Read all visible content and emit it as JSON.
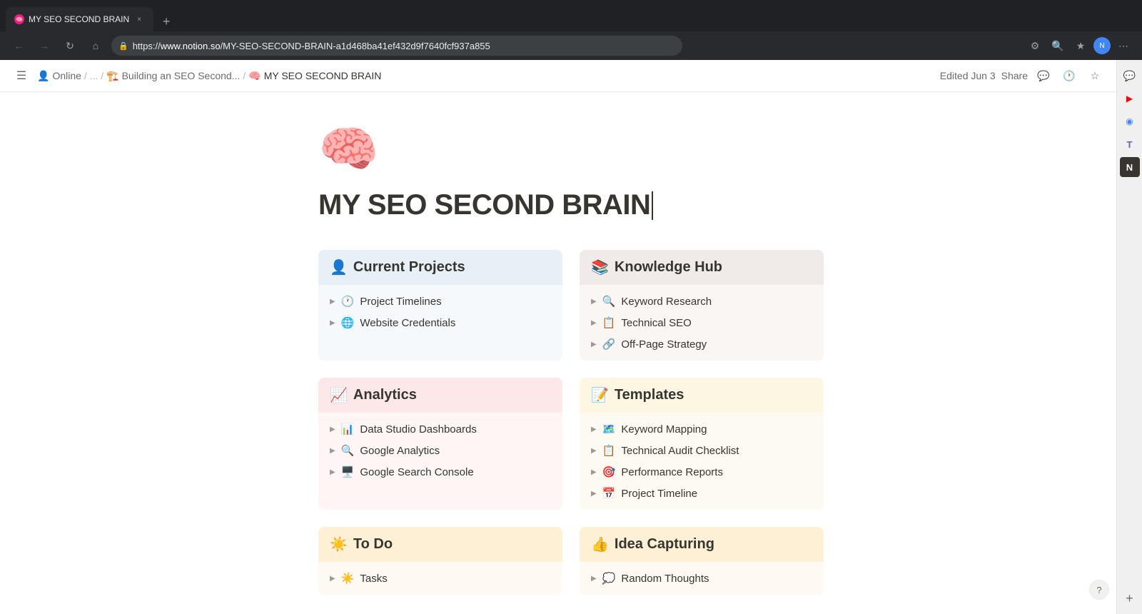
{
  "browser": {
    "tab": {
      "favicon": "🧠",
      "title": "MY SEO SECOND BRAIN",
      "close": "×"
    },
    "new_tab": "+",
    "nav": {
      "back": "←",
      "forward": "→",
      "reload": "↻",
      "home": "⌂"
    },
    "url": {
      "lock": "🔒",
      "full": "https://www.notion.so/MY-SEO-SECOND-BRAIN-a1d468ba41ef432d9f7640fcf937a855",
      "domain": "www.notion.so",
      "path": "/MY-SEO-SECOND-BRAIN-a1d468ba41ef432d9f7640fcf937a855"
    }
  },
  "notion": {
    "topbar": {
      "menu_icon": "☰",
      "breadcrumb": [
        {
          "icon": "👤",
          "label": "Online"
        },
        {
          "sep": "/ ... /"
        },
        {
          "icon": "🏗️",
          "label": "Building an SEO Second..."
        },
        {
          "sep": "/"
        },
        {
          "icon": "🧠",
          "label": "MY SEO SECOND BRAIN",
          "current": true
        }
      ],
      "edited": "Edited Jun 3",
      "share": "Share",
      "comment_icon": "💬",
      "history_icon": "🕐",
      "star_icon": "☆",
      "more_icon": "···"
    },
    "page": {
      "icon": "🧠",
      "title": "MY SEO SECOND BRAIN"
    },
    "sections": [
      {
        "id": "current-projects",
        "header_icon": "👤",
        "title": "Current Projects",
        "bg_class": "card-current-projects",
        "items": [
          {
            "icon": "🕐",
            "text": "Project Timelines"
          },
          {
            "icon": "🌐",
            "text": "Website Credentials"
          }
        ]
      },
      {
        "id": "knowledge-hub",
        "header_icon": "📚",
        "title": "Knowledge Hub",
        "bg_class": "card-knowledge-hub",
        "items": [
          {
            "icon": "🔍",
            "text": "Keyword Research"
          },
          {
            "icon": "📋",
            "text": "Technical SEO"
          },
          {
            "icon": "🔗",
            "text": "Off-Page Strategy"
          }
        ]
      },
      {
        "id": "analytics",
        "header_icon": "📈",
        "title": "Analytics",
        "bg_class": "card-analytics",
        "items": [
          {
            "icon": "📊",
            "text": "Data Studio Dashboards"
          },
          {
            "icon": "🔍",
            "text": "Google Analytics"
          },
          {
            "icon": "🖥️",
            "text": "Google Search Console"
          }
        ]
      },
      {
        "id": "templates",
        "header_icon": "📝",
        "title": "Templates",
        "bg_class": "card-templates",
        "items": [
          {
            "icon": "🗺️",
            "text": "Keyword Mapping"
          },
          {
            "icon": "📋",
            "text": "Technical Audit Checklist"
          },
          {
            "icon": "🎯",
            "text": "Performance Reports"
          },
          {
            "icon": "📅",
            "text": "Project Timeline"
          }
        ]
      },
      {
        "id": "todo",
        "header_icon": "☀️",
        "title": "To Do",
        "bg_class": "card-todo",
        "items": [
          {
            "icon": "☀️",
            "text": "Tasks"
          }
        ]
      },
      {
        "id": "idea-capturing",
        "header_icon": "👍",
        "title": "Idea Capturing",
        "bg_class": "card-idea",
        "items": [
          {
            "icon": "💭",
            "text": "Random Thoughts"
          }
        ]
      }
    ],
    "right_sidebar": {
      "icons": [
        {
          "name": "whatsapp-icon",
          "glyph": "💬",
          "class": "whatsapp"
        },
        {
          "name": "youtube-icon",
          "glyph": "▶",
          "class": "youtube"
        },
        {
          "name": "chrome-icon",
          "glyph": "◉",
          "class": "chrome"
        },
        {
          "name": "teams-icon",
          "glyph": "T",
          "class": "teams"
        },
        {
          "name": "notion-icon",
          "glyph": "N",
          "class": "notion"
        }
      ],
      "add": "+"
    },
    "help": "?"
  }
}
